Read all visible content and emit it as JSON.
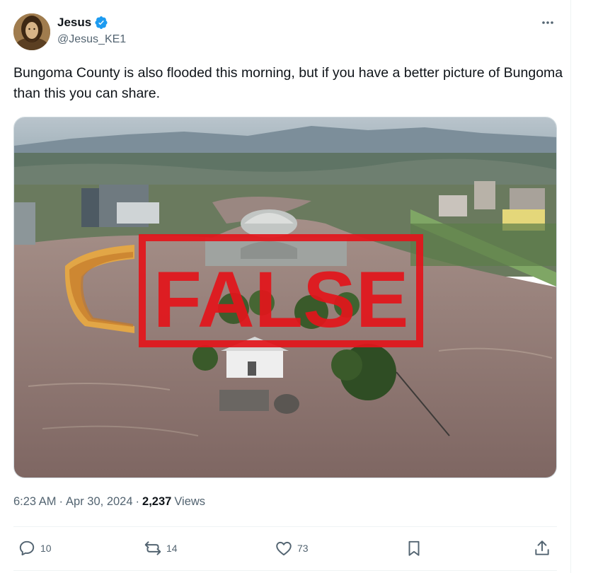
{
  "author": {
    "display_name": "Jesus",
    "handle": "@Jesus_KE1",
    "verified_icon": "verified-badge-icon"
  },
  "tweet": {
    "text": "Bungoma County is also flooded this morning, but if you have a better picture of Bungoma than this you can share.",
    "time": "6:23 AM",
    "separator": "·",
    "date": "Apr 30, 2024",
    "views_count": "2,237",
    "views_label": "Views"
  },
  "media": {
    "stamp_text": "FALSE"
  },
  "actions": {
    "replies": "10",
    "reposts": "14",
    "likes": "73"
  },
  "colors": {
    "accent": "#1d9bf0",
    "secondary_text": "#536471",
    "stamp_red": "#e3151b"
  }
}
